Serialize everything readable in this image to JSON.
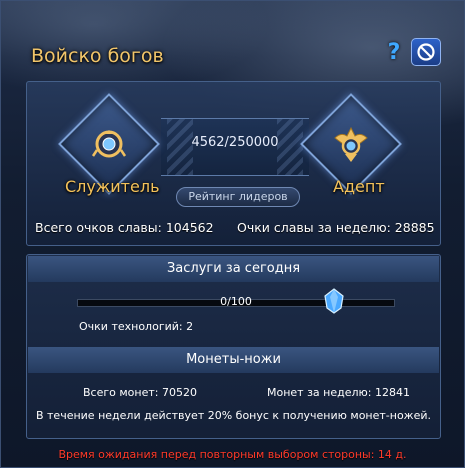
{
  "window": {
    "title": "Войско богов"
  },
  "top": {
    "progress": "4562/250000",
    "rank_current": "Служитель",
    "rank_next": "Адепт",
    "ranking_button": "Рейтинг лидеров",
    "total_glory_label": "Всего очков славы:",
    "total_glory_value": "104562",
    "weekly_glory_label": "Очки славы за неделю:",
    "weekly_glory_value": "28885"
  },
  "merits": {
    "header": "Заслуги за сегодня",
    "progress_text": "0/100",
    "progress_fraction": 0,
    "tech_points": "Очки технологий: 2"
  },
  "coins": {
    "header": "Монеты-ножи",
    "total": "Всего монет: 70520",
    "weekly": "Монет за неделю: 12841",
    "bonus": "В течение недели действует 20% бонус к получению монет-ножей."
  },
  "footer": {
    "wait": "Время ожидания перед повторным выбором стороны: 14 д."
  },
  "icons": {
    "help": "question-icon",
    "close": "no-entry-icon",
    "crystal": "crystal-icon"
  },
  "colors": {
    "gold": "#f4c25a",
    "red": "#ff3a2a",
    "accent": "#3fa0ff"
  }
}
